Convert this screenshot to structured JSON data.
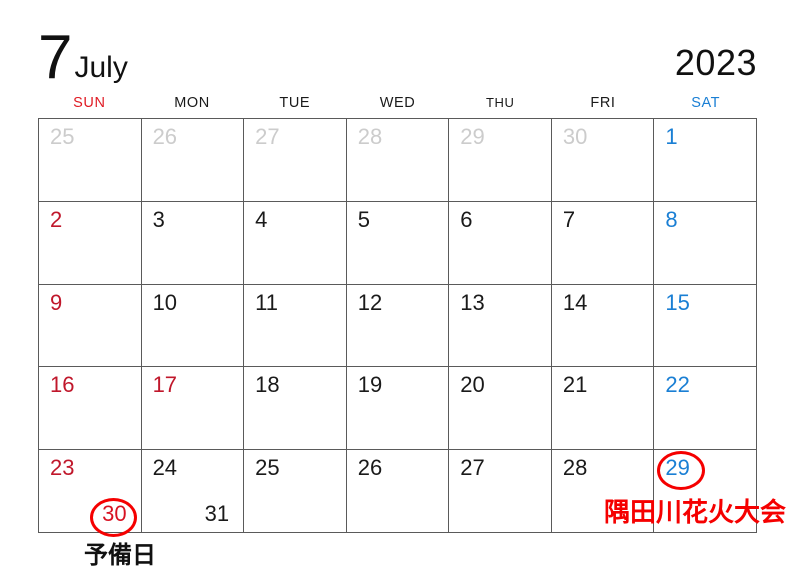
{
  "header": {
    "month_number": "7",
    "month_name": "July",
    "year": "2023"
  },
  "weekdays": [
    {
      "key": "sun",
      "label": "SUN"
    },
    {
      "key": "mon",
      "label": "MON"
    },
    {
      "key": "tue",
      "label": "TUE"
    },
    {
      "key": "wed",
      "label": "WED"
    },
    {
      "key": "thu",
      "label": "THU"
    },
    {
      "key": "fri",
      "label": "FRI"
    },
    {
      "key": "sat",
      "label": "SAT"
    }
  ],
  "colors": {
    "sunday_red": "#c0172b",
    "saturday_blue": "#1a7fd4",
    "muted_gray": "#cccccc",
    "annotation_red": "#f50000",
    "grid_line": "#5a5a5a",
    "text_black": "#1a1a1a"
  },
  "weeks": [
    {
      "days": [
        {
          "num": "25",
          "style": "muted"
        },
        {
          "num": "26",
          "style": "muted"
        },
        {
          "num": "27",
          "style": "muted"
        },
        {
          "num": "28",
          "style": "muted"
        },
        {
          "num": "29",
          "style": "muted"
        },
        {
          "num": "30",
          "style": "muted"
        },
        {
          "num": "1",
          "style": "sat"
        }
      ]
    },
    {
      "days": [
        {
          "num": "2",
          "style": "sun"
        },
        {
          "num": "3",
          "style": "normal"
        },
        {
          "num": "4",
          "style": "normal"
        },
        {
          "num": "5",
          "style": "normal"
        },
        {
          "num": "6",
          "style": "normal"
        },
        {
          "num": "7",
          "style": "normal"
        },
        {
          "num": "8",
          "style": "sat"
        }
      ]
    },
    {
      "days": [
        {
          "num": "9",
          "style": "sun"
        },
        {
          "num": "10",
          "style": "normal"
        },
        {
          "num": "11",
          "style": "normal"
        },
        {
          "num": "12",
          "style": "normal"
        },
        {
          "num": "13",
          "style": "normal"
        },
        {
          "num": "14",
          "style": "normal"
        },
        {
          "num": "15",
          "style": "sat"
        }
      ]
    },
    {
      "days": [
        {
          "num": "16",
          "style": "sun"
        },
        {
          "num": "17",
          "style": "holiday"
        },
        {
          "num": "18",
          "style": "normal"
        },
        {
          "num": "19",
          "style": "normal"
        },
        {
          "num": "20",
          "style": "normal"
        },
        {
          "num": "21",
          "style": "normal"
        },
        {
          "num": "22",
          "style": "sat"
        }
      ]
    },
    {
      "days": [
        {
          "num": "23",
          "style": "sun",
          "extra_num": "30",
          "extra_style": "br red"
        },
        {
          "num": "24",
          "style": "normal",
          "extra_num": "31",
          "extra_style": "br"
        },
        {
          "num": "25",
          "style": "normal"
        },
        {
          "num": "26",
          "style": "normal"
        },
        {
          "num": "27",
          "style": "normal"
        },
        {
          "num": "28",
          "style": "normal"
        },
        {
          "num": "29",
          "style": "sat"
        }
      ]
    }
  ],
  "annotations": {
    "circle_29_day": "29",
    "circle_30_day": "30",
    "event_label": "隅田川花火大会",
    "note_label": "予備日"
  }
}
